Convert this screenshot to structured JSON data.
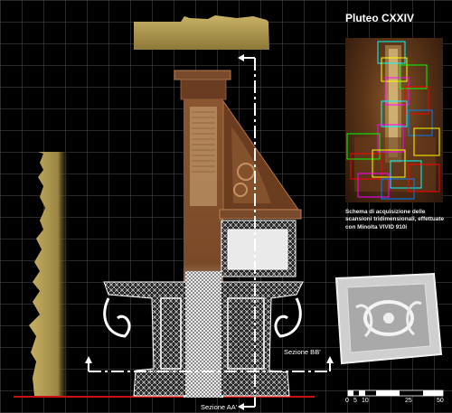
{
  "title": "Pluteo CXXIV",
  "caption": "Schema di acquisizione delle scansioni tridimensionali, effettuate con Minolta VIVID 910i",
  "section_bb": "Sezione BB'",
  "section_aa": "Sezione AA'",
  "scale_ticks": [
    "0",
    "5",
    "10",
    "25",
    "50"
  ],
  "colors": {
    "background": "#000000",
    "gold": "#b09a55",
    "ground_line": "#cc1111",
    "wood": "#8a5530"
  }
}
